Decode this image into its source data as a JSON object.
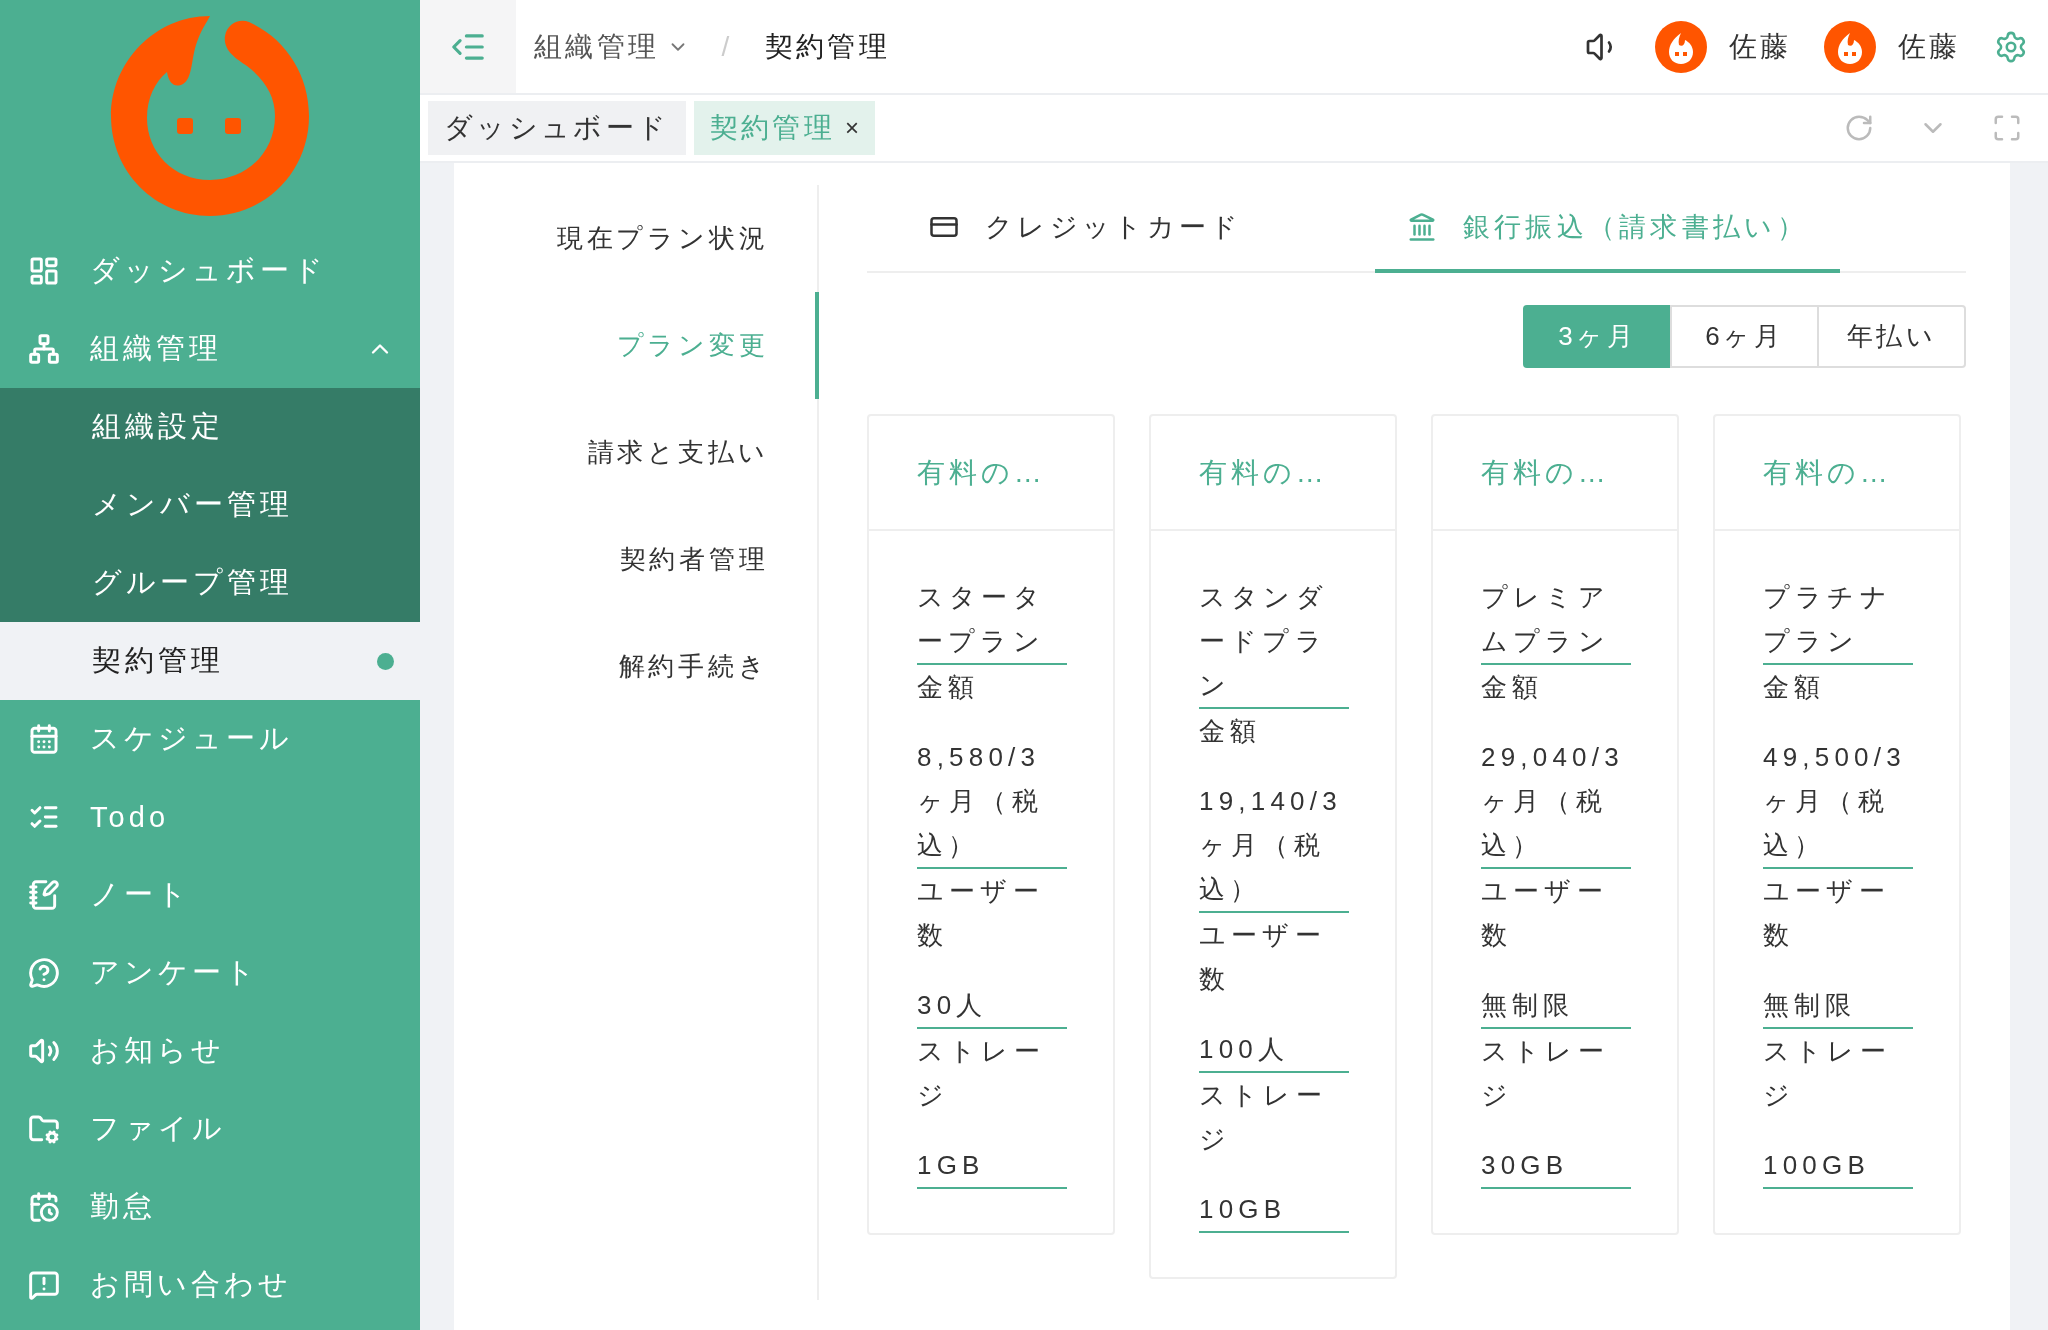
{
  "sidebar": {
    "items": [
      {
        "label": "ダッシュボード",
        "selected": false
      },
      {
        "label": "組織管理",
        "selected": false,
        "expanded": true,
        "children": [
          {
            "label": "組織設定",
            "selected": false
          },
          {
            "label": "メンバー管理",
            "selected": false
          },
          {
            "label": "グループ管理",
            "selected": false
          }
        ]
      },
      {
        "label": "契約管理",
        "selected": true,
        "sub": true
      },
      {
        "label": "スケジュール",
        "selected": false
      },
      {
        "label": "Todo",
        "selected": false
      },
      {
        "label": "ノート",
        "selected": false
      },
      {
        "label": "アンケート",
        "selected": false
      },
      {
        "label": "お知らせ",
        "selected": false
      },
      {
        "label": "ファイル",
        "selected": false
      },
      {
        "label": "勤怠",
        "selected": false
      },
      {
        "label": "お問い合わせ",
        "selected": false
      }
    ]
  },
  "header": {
    "breadcrumb": [
      {
        "label": "組織管理",
        "dropdown": true
      },
      {
        "label": "契約管理",
        "dropdown": false
      }
    ],
    "separator": "/",
    "users": [
      {
        "name": "佐藤"
      },
      {
        "name": "佐藤"
      }
    ]
  },
  "tabs": [
    {
      "label": "ダッシュボード",
      "selected": false
    },
    {
      "label": "契約管理",
      "selected": true,
      "close": "×"
    }
  ],
  "contract_nav": [
    {
      "label": "現在プラン状況",
      "selected": false
    },
    {
      "label": "プラン変更",
      "selected": true
    },
    {
      "label": "請求と支払い",
      "selected": false
    },
    {
      "label": "契約者管理",
      "selected": false
    },
    {
      "label": "解約手続き",
      "selected": false
    }
  ],
  "payment_tabs": [
    {
      "label": "クレジットカード",
      "selected": false
    },
    {
      "label": "銀行振込（請求書払い）",
      "selected": true
    }
  ],
  "periods": [
    {
      "label": "3ヶ月",
      "selected": true
    },
    {
      "label": "6ヶ月",
      "selected": false
    },
    {
      "label": "年払い",
      "selected": false
    }
  ],
  "plans": [
    {
      "title": "有料の…",
      "name": "スタータープラン",
      "fields": [
        {
          "label": "金額",
          "value": "8,580/3ヶ月（税込）"
        },
        {
          "label": "ユーザー数",
          "value": "30人"
        },
        {
          "label": "ストレージ",
          "value": "1GB"
        }
      ]
    },
    {
      "title": "有料の…",
      "name": "スタンダードプラン",
      "fields": [
        {
          "label": "金額",
          "value": "19,140/3ヶ月（税込）"
        },
        {
          "label": "ユーザー数",
          "value": "100人"
        },
        {
          "label": "ストレージ",
          "value": "10GB"
        }
      ]
    },
    {
      "title": "有料の…",
      "name": "プレミアムプラン",
      "fields": [
        {
          "label": "金額",
          "value": "29,040/3ヶ月（税込）"
        },
        {
          "label": "ユーザー数",
          "value": "無制限"
        },
        {
          "label": "ストレージ",
          "value": "30GB"
        }
      ]
    },
    {
      "title": "有料の…",
      "name": "プラチナプラン",
      "fields": [
        {
          "label": "金額",
          "value": "49,500/3ヶ月（税込）"
        },
        {
          "label": "ユーザー数",
          "value": "無制限"
        },
        {
          "label": "ストレージ",
          "value": "100GB"
        }
      ]
    }
  ]
}
